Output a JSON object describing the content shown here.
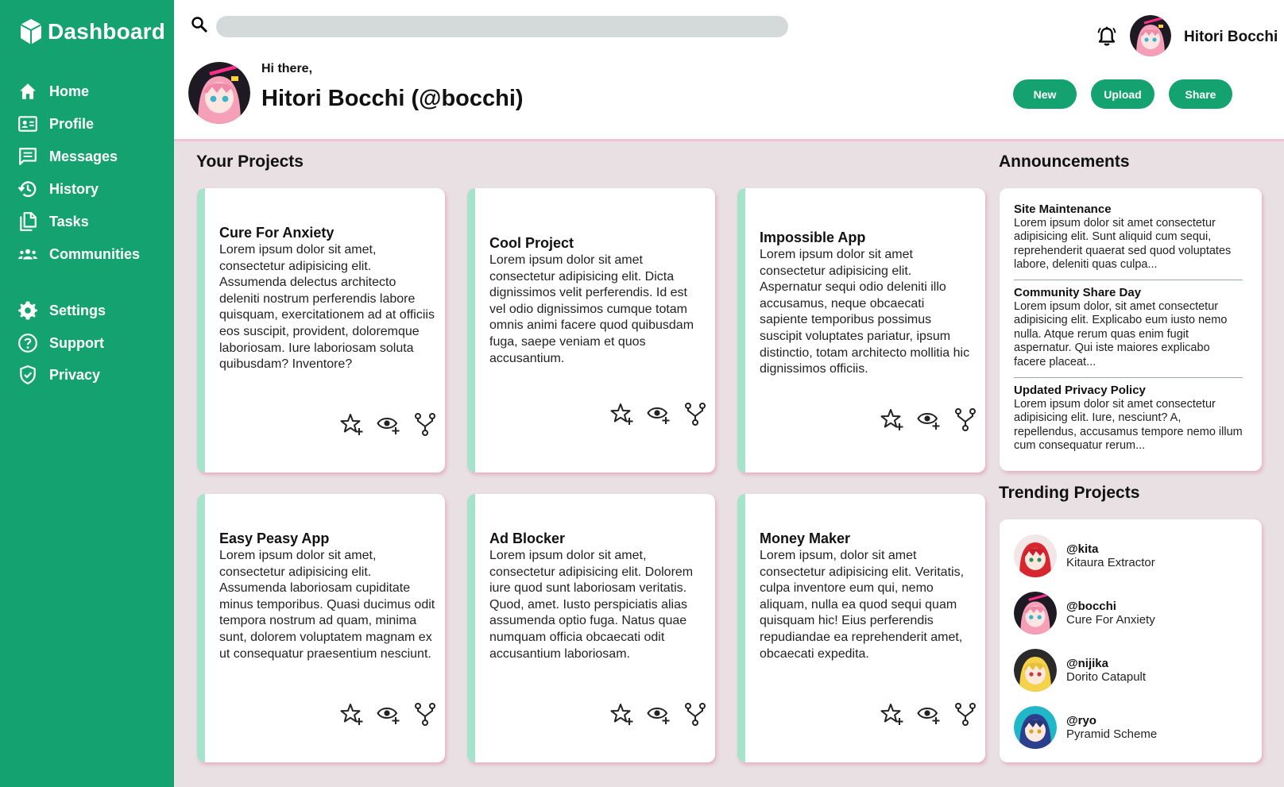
{
  "sidebar": {
    "brand": "Dashboard",
    "items": [
      {
        "label": "Home",
        "icon": "home-icon"
      },
      {
        "label": "Profile",
        "icon": "id-card-icon"
      },
      {
        "label": "Messages",
        "icon": "message-icon"
      },
      {
        "label": "History",
        "icon": "history-icon"
      },
      {
        "label": "Tasks",
        "icon": "tasks-icon"
      },
      {
        "label": "Communities",
        "icon": "group-icon"
      },
      {
        "label": "Settings",
        "icon": "gear-icon"
      },
      {
        "label": "Support",
        "icon": "help-icon"
      },
      {
        "label": "Privacy",
        "icon": "shield-icon"
      }
    ]
  },
  "header": {
    "search": {
      "value": "",
      "placeholder": ""
    },
    "user_name": "Hitori Bocchi",
    "greeting": "Hi there,",
    "greeting_name": "Hitori Bocchi (@bocchi)",
    "buttons": {
      "new": "New",
      "upload": "Upload",
      "share": "Share"
    }
  },
  "projects": {
    "title": "Your Projects",
    "items": [
      {
        "title": "Cure For Anxiety",
        "body": "Lorem ipsum dolor sit amet, consectetur adipisicing elit. Assumenda delectus architecto deleniti nostrum perferendis labore quisquam, exercitationem ad at officiis eos suscipit, provident, doloremque laboriosam. Iure laboriosam soluta quibusdam? Inventore?"
      },
      {
        "title": "Cool Project",
        "body": "Lorem ipsum dolor sit amet consectetur adipisicing elit. Dicta dignissimos velit perferendis. Id est vel odio dignissimos cumque totam omnis animi facere quod quibusdam fuga, saepe veniam et quos accusantium."
      },
      {
        "title": "Impossible App",
        "body": "Lorem ipsum dolor sit amet consectetur adipisicing elit. Aspernatur sequi odio deleniti illo accusamus, neque obcaecati sapiente temporibus possimus suscipit voluptates pariatur, ipsum distinctio, totam architecto mollitia hic dignissimos officiis."
      },
      {
        "title": "Easy Peasy App",
        "body": "Lorem ipsum dolor sit amet, consectetur adipisicing elit. Assumenda laboriosam cupiditate minus temporibus. Quasi ducimus odit tempora nostrum ad quam, minima sunt, dolorem voluptatem magnam ex ut consequatur praesentium nesciunt."
      },
      {
        "title": "Ad Blocker",
        "body": "Lorem ipsum dolor sit amet, consectetur adipisicing elit. Dolorem iure quod sunt laboriosam veritatis. Quod, amet. Iusto perspiciatis alias assumenda optio fuga. Natus quae numquam officia obcaecati odit accusantium laboriosam."
      },
      {
        "title": "Money Maker",
        "body": "Lorem ipsum, dolor sit amet consectetur adipisicing elit. Veritatis, culpa inventore eum qui, nemo aliquam, nulla ea quod sequi quam quisquam hic! Eius perferendis repudiandae ea reprehenderit amet, obcaecati expedita."
      }
    ]
  },
  "announcements": {
    "title": "Announcements",
    "items": [
      {
        "title": "Site Maintenance",
        "body": "Lorem ipsum dolor sit amet consectetur adipisicing elit. Sunt aliquid cum sequi, reprehenderit quaerat sed quod voluptates labore, deleniti quas culpa..."
      },
      {
        "title": "Community Share Day",
        "body": "Lorem ipsum dolor, sit amet consectetur adipisicing elit. Explicabo eum iusto nemo nulla. Atque rerum quas enim fugit aspernatur. Qui iste maiores explicabo facere placeat..."
      },
      {
        "title": "Updated Privacy Policy",
        "body": "Lorem ipsum dolor sit amet consectetur adipisicing elit. Iure, nesciunt? A, repellendus, accusamus tempore nemo illum cum consequatur rerum..."
      }
    ]
  },
  "trending": {
    "title": "Trending Projects",
    "items": [
      {
        "handle": "@kita",
        "project": "Kitaura Extractor"
      },
      {
        "handle": "@bocchi",
        "project": "Cure For Anxiety"
      },
      {
        "handle": "@nijika",
        "project": "Dorito Catapult"
      },
      {
        "handle": "@ryo",
        "project": "Pyramid Scheme"
      }
    ]
  },
  "colors": {
    "brand_green": "#15a271",
    "card_accent": "#a6e3cc",
    "page_bg": "#e8e0e2",
    "shadow_pink": "#e18caf"
  }
}
